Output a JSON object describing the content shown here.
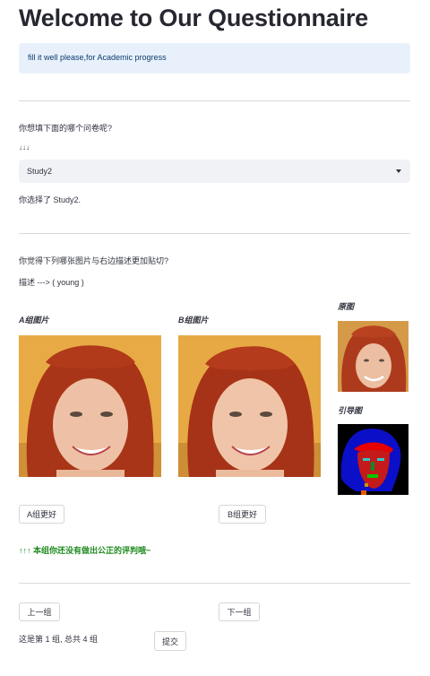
{
  "header": {
    "title": "Welcome to Our Questionnaire",
    "info": "fill it well please,for Academic progress"
  },
  "survey": {
    "question": "你想填下面的哪个问卷呢?",
    "arrows": "↓↓↓",
    "selected": "Study2",
    "selected_text": "你选择了 Study2."
  },
  "compare": {
    "question": "你觉得下列哪张图片与右边描述更加贴切?",
    "description": "描述 ---> ( young )",
    "group_a_label": "A组图片",
    "group_b_label": "B组图片",
    "original_label": "原图",
    "guide_label": "引导图",
    "a_button": "A组更好",
    "b_button": "B组更好",
    "notice": "↑↑↑ 本组你还没有做出公正的评判哦~"
  },
  "nav": {
    "prev": "上一组",
    "next": "下一组",
    "page_status": "这是第 1 组, 总共 4 组",
    "submit": "提交"
  },
  "colors": {
    "info_bg": "#e8f1fb",
    "notice": "#1d8a1d",
    "select_bg": "#f0f2f6"
  }
}
